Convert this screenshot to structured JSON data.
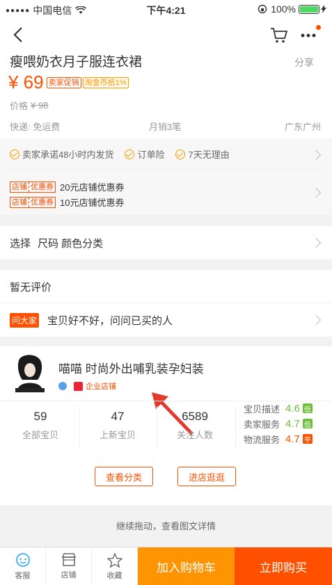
{
  "status": {
    "carrier": "中国电信",
    "time": "下午4:21",
    "battery": "100%"
  },
  "product": {
    "title": "瘦喂奶衣月子服连衣裙",
    "share": "分享",
    "price": "¥ 69",
    "tags": [
      "卖家促销",
      "淘金币抵1%"
    ],
    "original_price_label": "价格",
    "original_price": "¥ 98",
    "shipping": "快递: 免运费",
    "monthly_sales": "月销3笔",
    "location": "广东广州"
  },
  "promises": [
    "卖家承诺48小时内发货",
    "订单险",
    "7天无理由"
  ],
  "coupons": [
    {
      "tag_a": "店铺",
      "tag_b": "优惠券",
      "text": "20元店铺优惠券"
    },
    {
      "tag_a": "店铺",
      "tag_b": "优惠券",
      "text": "10元店铺优惠券"
    }
  ],
  "select": {
    "label": "选择",
    "options": "尺码 颜色分类"
  },
  "reviews": {
    "title": "暂无评价",
    "ask_badge": "问大家",
    "ask_text": "宝贝好不好，问问已买的人"
  },
  "shop": {
    "name": "喵喵 时尚外出哺乳装孕妇装",
    "badge": "企业店铺",
    "stats": [
      {
        "num": "59",
        "label": "全部宝贝"
      },
      {
        "num": "47",
        "label": "上新宝贝"
      },
      {
        "num": "6589",
        "label": "关注人数"
      }
    ],
    "scores": [
      {
        "label": "宝贝描述",
        "value": "4.6",
        "level": "低",
        "color": "#6cbf3a"
      },
      {
        "label": "卖家服务",
        "value": "4.7",
        "level": "低",
        "color": "#6cbf3a"
      },
      {
        "label": "物流服务",
        "value": "4.7",
        "level": "平",
        "color": "#ff5000"
      }
    ],
    "btn_category": "查看分类",
    "btn_enter": "进店逛逛"
  },
  "continue_text": "继续拖动，查看图文详情",
  "bottom": {
    "service": "客服",
    "store": "店铺",
    "favorite": "收藏",
    "add_cart": "加入购物车",
    "buy_now": "立即购买"
  },
  "colors": {
    "accent": "#ff5000",
    "cart": "#ff9402",
    "buy": "#ff5000"
  }
}
